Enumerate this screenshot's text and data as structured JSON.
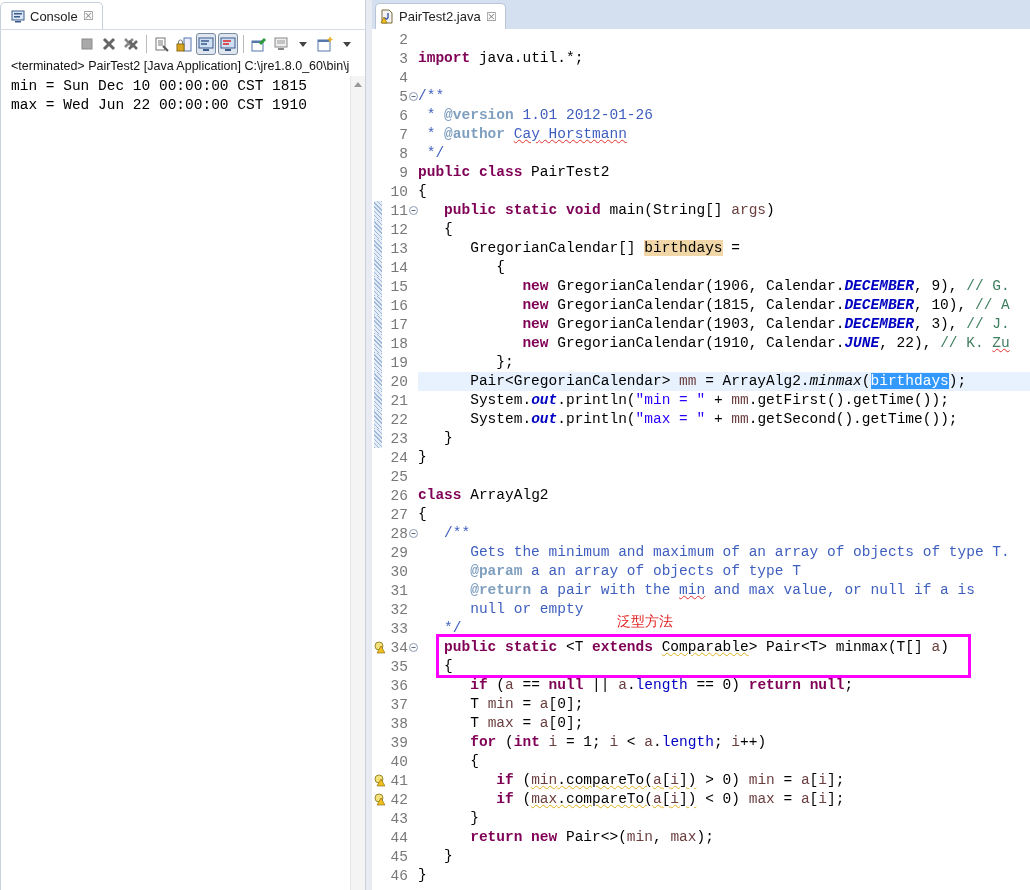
{
  "console": {
    "tab": {
      "label": "Console",
      "close": "☒",
      "selected": true
    },
    "toolbar": [
      {
        "kind": "stop",
        "pressed": false
      },
      {
        "kind": "remove",
        "pressed": false
      },
      {
        "kind": "remove-all",
        "pressed": false
      },
      {
        "kind": "separator"
      },
      {
        "kind": "document",
        "pressed": false
      },
      {
        "kind": "lock",
        "pressed": false
      },
      {
        "kind": "monitor",
        "pressed": true
      },
      {
        "kind": "monitor-error",
        "pressed": true
      },
      {
        "kind": "separator"
      },
      {
        "kind": "pin",
        "pressed": false
      },
      {
        "kind": "display",
        "pressed": false
      },
      {
        "kind": "dropdown",
        "pressed": false
      },
      {
        "kind": "window",
        "pressed": false
      },
      {
        "kind": "dropdown",
        "pressed": false
      }
    ],
    "status": "<terminated> PairTest2 [Java Application] C:\\jre1.8.0_60\\bin\\j",
    "output": [
      "min = Sun Dec 10 00:00:00 CST 1815",
      "max = Wed Jun 22 00:00:00 CST 1910"
    ]
  },
  "editor": {
    "tabs": [
      {
        "label": "PairTest2.java",
        "close": "☒",
        "selected": true
      }
    ],
    "annotation": {
      "label": "泛型方法"
    },
    "lines": [
      {
        "number": "2"
      },
      {
        "number": "3",
        "tokens": [
          {
            "text": "import",
            "kind": "keyword"
          },
          {
            "text": " java.util.*;",
            "kind": "plain"
          }
        ]
      },
      {
        "number": "4"
      },
      {
        "number": "5",
        "fold": true,
        "tokens": [
          {
            "text": "/**",
            "kind": "comment"
          }
        ]
      },
      {
        "number": "6",
        "tokens": [
          {
            "text": " * ",
            "kind": "comment"
          },
          {
            "text": "@version",
            "kind": "tag"
          },
          {
            "text": " 1.01 2012-01-26",
            "kind": "comment"
          }
        ]
      },
      {
        "number": "7",
        "tokens": [
          {
            "text": " * ",
            "kind": "comment"
          },
          {
            "text": "@author ",
            "kind": "tag"
          },
          {
            "text": "Cay",
            "kind": "comment",
            "misspelled": true
          },
          {
            "text": " Horstmann",
            "kind": "comment",
            "misspelled": true
          }
        ]
      },
      {
        "number": "8",
        "tokens": [
          {
            "text": " */",
            "kind": "comment"
          }
        ]
      },
      {
        "number": "9",
        "tokens": [
          {
            "text": "public class",
            "kind": "keyword"
          },
          {
            "text": " PairTest2",
            "kind": "plain"
          }
        ]
      },
      {
        "number": "10",
        "tokens": [
          {
            "text": "{",
            "kind": "plain"
          }
        ]
      },
      {
        "number": "11",
        "fold": true,
        "ruler": true,
        "tokens": [
          {
            "text": "   public static void",
            "kind": "keyword"
          },
          {
            "text": " main(String[] ",
            "kind": "plain"
          },
          {
            "text": "args",
            "kind": "local"
          },
          {
            "text": ")",
            "kind": "plain"
          }
        ]
      },
      {
        "number": "12",
        "ruler": true,
        "tokens": [
          {
            "text": "   {",
            "kind": "plain"
          }
        ]
      },
      {
        "number": "13",
        "ruler": true,
        "tokens": [
          {
            "text": "      GregorianCalendar[] ",
            "kind": "plain"
          },
          {
            "text": "birthdays",
            "kind": "occurrence"
          },
          {
            "text": " =",
            "kind": "plain"
          }
        ]
      },
      {
        "number": "14",
        "ruler": true,
        "tokens": [
          {
            "text": "         {",
            "kind": "plain"
          }
        ]
      },
      {
        "number": "15",
        "ruler": true,
        "tokens": [
          {
            "text": "            new",
            "kind": "keyword"
          },
          {
            "text": " GregorianCalendar(1906, Calendar.",
            "kind": "plain"
          },
          {
            "text": "DECEMBER",
            "kind": "static"
          },
          {
            "text": ", 9), ",
            "kind": "plain"
          },
          {
            "text": "// G.",
            "kind": "line-comment"
          }
        ]
      },
      {
        "number": "16",
        "ruler": true,
        "tokens": [
          {
            "text": "            new",
            "kind": "keyword"
          },
          {
            "text": " GregorianCalendar(1815, Calendar.",
            "kind": "plain"
          },
          {
            "text": "DECEMBER",
            "kind": "static"
          },
          {
            "text": ", 10), ",
            "kind": "plain"
          },
          {
            "text": "// A",
            "kind": "line-comment"
          }
        ]
      },
      {
        "number": "17",
        "ruler": true,
        "tokens": [
          {
            "text": "            new",
            "kind": "keyword"
          },
          {
            "text": " GregorianCalendar(1903, Calendar.",
            "kind": "plain"
          },
          {
            "text": "DECEMBER",
            "kind": "static"
          },
          {
            "text": ", 3), ",
            "kind": "plain"
          },
          {
            "text": "// J.",
            "kind": "line-comment"
          }
        ]
      },
      {
        "number": "18",
        "ruler": true,
        "tokens": [
          {
            "text": "            new",
            "kind": "keyword"
          },
          {
            "text": " GregorianCalendar(1910, Calendar.",
            "kind": "plain"
          },
          {
            "text": "JUNE",
            "kind": "static"
          },
          {
            "text": ", 22), ",
            "kind": "plain"
          },
          {
            "text": "// K. ",
            "kind": "line-comment"
          },
          {
            "text": "Zu",
            "kind": "line-comment",
            "misspelled": true
          }
        ]
      },
      {
        "number": "19",
        "ruler": true,
        "tokens": [
          {
            "text": "         };",
            "kind": "plain"
          }
        ]
      },
      {
        "number": "20",
        "ruler": true,
        "current": true,
        "tokens": [
          {
            "text": "      Pair<GregorianCalendar> ",
            "kind": "plain"
          },
          {
            "text": "mm",
            "kind": "local"
          },
          {
            "text": " = ArrayAlg2.",
            "kind": "plain"
          },
          {
            "text": "minmax",
            "kind": "static-method"
          },
          {
            "text": "(",
            "kind": "plain"
          },
          {
            "text": "birthdays",
            "kind": "selection"
          },
          {
            "text": ");",
            "kind": "plain"
          }
        ]
      },
      {
        "number": "21",
        "ruler": true,
        "tokens": [
          {
            "text": "      System.",
            "kind": "plain"
          },
          {
            "text": "out",
            "kind": "static"
          },
          {
            "text": ".println(",
            "kind": "plain"
          },
          {
            "text": "\"min = \"",
            "kind": "string"
          },
          {
            "text": " + ",
            "kind": "plain"
          },
          {
            "text": "mm",
            "kind": "local"
          },
          {
            "text": ".getFirst().getTime());",
            "kind": "plain"
          }
        ]
      },
      {
        "number": "22",
        "ruler": true,
        "tokens": [
          {
            "text": "      System.",
            "kind": "plain"
          },
          {
            "text": "out",
            "kind": "static"
          },
          {
            "text": ".println(",
            "kind": "plain"
          },
          {
            "text": "\"max = \"",
            "kind": "string"
          },
          {
            "text": " + ",
            "kind": "plain"
          },
          {
            "text": "mm",
            "kind": "local"
          },
          {
            "text": ".getSecond().getTime());",
            "kind": "plain"
          }
        ]
      },
      {
        "number": "23",
        "ruler": true,
        "tokens": [
          {
            "text": "   }",
            "kind": "plain"
          }
        ]
      },
      {
        "number": "24",
        "tokens": [
          {
            "text": "}",
            "kind": "plain"
          }
        ]
      },
      {
        "number": "25"
      },
      {
        "number": "26",
        "tokens": [
          {
            "text": "class",
            "kind": "keyword"
          },
          {
            "text": " ArrayAlg2",
            "kind": "plain"
          }
        ]
      },
      {
        "number": "27",
        "tokens": [
          {
            "text": "{",
            "kind": "plain"
          }
        ]
      },
      {
        "number": "28",
        "fold": true,
        "tokens": [
          {
            "text": "   /**",
            "kind": "comment"
          }
        ]
      },
      {
        "number": "29",
        "tokens": [
          {
            "text": "      Gets the minimum and maximum of an array of objects of type T.",
            "kind": "comment"
          }
        ]
      },
      {
        "number": "30",
        "tokens": [
          {
            "text": "      @param",
            "kind": "tag"
          },
          {
            "text": " a an array of objects of type T",
            "kind": "comment"
          }
        ]
      },
      {
        "number": "31",
        "tokens": [
          {
            "text": "      @return",
            "kind": "tag"
          },
          {
            "text": " a pair with the ",
            "kind": "comment"
          },
          {
            "text": "min",
            "kind": "comment",
            "misspelled": true
          },
          {
            "text": " and max value, or null if a is",
            "kind": "comment"
          }
        ]
      },
      {
        "number": "32",
        "tokens": [
          {
            "text": "      null or empty",
            "kind": "comment"
          }
        ]
      },
      {
        "number": "33",
        "tokens": [
          {
            "text": "   */",
            "kind": "comment"
          }
        ]
      },
      {
        "number": "34",
        "fold": true,
        "warning": true,
        "boxed": true,
        "tokens": [
          {
            "text": "   public static",
            "kind": "keyword"
          },
          {
            "text": " <T ",
            "kind": "plain"
          },
          {
            "text": "extends ",
            "kind": "keyword"
          },
          {
            "text": "Comparable",
            "kind": "plain",
            "warned": true
          },
          {
            "text": "> Pair<T> minmax(T[] ",
            "kind": "plain"
          },
          {
            "text": "a",
            "kind": "local"
          },
          {
            "text": ")",
            "kind": "plain"
          }
        ]
      },
      {
        "number": "35",
        "boxed": true,
        "tokens": [
          {
            "text": "   {",
            "kind": "plain"
          }
        ]
      },
      {
        "number": "36",
        "tokens": [
          {
            "text": "      if",
            "kind": "keyword"
          },
          {
            "text": " (",
            "kind": "plain"
          },
          {
            "text": "a",
            "kind": "local"
          },
          {
            "text": " == ",
            "kind": "plain"
          },
          {
            "text": "null",
            "kind": "keyword"
          },
          {
            "text": " || ",
            "kind": "plain"
          },
          {
            "text": "a",
            "kind": "local"
          },
          {
            "text": ".",
            "kind": "plain"
          },
          {
            "text": "length",
            "kind": "field"
          },
          {
            "text": " == 0) ",
            "kind": "plain"
          },
          {
            "text": "return null",
            "kind": "keyword"
          },
          {
            "text": ";",
            "kind": "plain"
          }
        ]
      },
      {
        "number": "37",
        "tokens": [
          {
            "text": "      T ",
            "kind": "plain"
          },
          {
            "text": "min",
            "kind": "local"
          },
          {
            "text": " = ",
            "kind": "plain"
          },
          {
            "text": "a",
            "kind": "local"
          },
          {
            "text": "[0];",
            "kind": "plain"
          }
        ]
      },
      {
        "number": "38",
        "tokens": [
          {
            "text": "      T ",
            "kind": "plain"
          },
          {
            "text": "max",
            "kind": "local"
          },
          {
            "text": " = ",
            "kind": "plain"
          },
          {
            "text": "a",
            "kind": "local"
          },
          {
            "text": "[0];",
            "kind": "plain"
          }
        ]
      },
      {
        "number": "39",
        "tokens": [
          {
            "text": "      for",
            "kind": "keyword"
          },
          {
            "text": " (",
            "kind": "plain"
          },
          {
            "text": "int",
            "kind": "keyword"
          },
          {
            "text": " i",
            "kind": "local"
          },
          {
            "text": " = 1; ",
            "kind": "plain"
          },
          {
            "text": "i",
            "kind": "local"
          },
          {
            "text": " < ",
            "kind": "plain"
          },
          {
            "text": "a",
            "kind": "local"
          },
          {
            "text": ".",
            "kind": "plain"
          },
          {
            "text": "length",
            "kind": "field"
          },
          {
            "text": "; ",
            "kind": "plain"
          },
          {
            "text": "i",
            "kind": "local"
          },
          {
            "text": "++)",
            "kind": "plain"
          }
        ]
      },
      {
        "number": "40",
        "tokens": [
          {
            "text": "      {",
            "kind": "plain"
          }
        ]
      },
      {
        "number": "41",
        "warning": true,
        "tokens": [
          {
            "text": "         if",
            "kind": "keyword"
          },
          {
            "text": " (",
            "kind": "plain"
          },
          {
            "text": "min",
            "kind": "local",
            "warned": true
          },
          {
            "text": ".compareTo(",
            "kind": "plain",
            "warned": true
          },
          {
            "text": "a",
            "kind": "local",
            "warned": true
          },
          {
            "text": "[",
            "kind": "plain",
            "warned": true
          },
          {
            "text": "i",
            "kind": "local",
            "warned": true
          },
          {
            "text": "])",
            "kind": "plain",
            "warned": true
          },
          {
            "text": " > 0) ",
            "kind": "plain"
          },
          {
            "text": "min",
            "kind": "local"
          },
          {
            "text": " = ",
            "kind": "plain"
          },
          {
            "text": "a",
            "kind": "local"
          },
          {
            "text": "[",
            "kind": "plain"
          },
          {
            "text": "i",
            "kind": "local"
          },
          {
            "text": "];",
            "kind": "plain"
          }
        ]
      },
      {
        "number": "42",
        "warning": true,
        "tokens": [
          {
            "text": "         if",
            "kind": "keyword"
          },
          {
            "text": " (",
            "kind": "plain"
          },
          {
            "text": "max",
            "kind": "local",
            "warned": true
          },
          {
            "text": ".compareTo(",
            "kind": "plain",
            "warned": true
          },
          {
            "text": "a",
            "kind": "local",
            "warned": true
          },
          {
            "text": "[",
            "kind": "plain",
            "warned": true
          },
          {
            "text": "i",
            "kind": "local",
            "warned": true
          },
          {
            "text": "])",
            "kind": "plain",
            "warned": true
          },
          {
            "text": " < 0) ",
            "kind": "plain"
          },
          {
            "text": "max",
            "kind": "local"
          },
          {
            "text": " = ",
            "kind": "plain"
          },
          {
            "text": "a",
            "kind": "local"
          },
          {
            "text": "[",
            "kind": "plain"
          },
          {
            "text": "i",
            "kind": "local"
          },
          {
            "text": "];",
            "kind": "plain"
          }
        ]
      },
      {
        "number": "43",
        "tokens": [
          {
            "text": "      }",
            "kind": "plain"
          }
        ]
      },
      {
        "number": "44",
        "tokens": [
          {
            "text": "      return new",
            "kind": "keyword"
          },
          {
            "text": " Pair<>(",
            "kind": "plain"
          },
          {
            "text": "min",
            "kind": "local"
          },
          {
            "text": ", ",
            "kind": "plain"
          },
          {
            "text": "max",
            "kind": "local"
          },
          {
            "text": ");",
            "kind": "plain"
          }
        ]
      },
      {
        "number": "45",
        "tokens": [
          {
            "text": "   }",
            "kind": "plain"
          }
        ]
      },
      {
        "number": "46",
        "tokens": [
          {
            "text": "}",
            "kind": "plain"
          }
        ]
      }
    ]
  }
}
